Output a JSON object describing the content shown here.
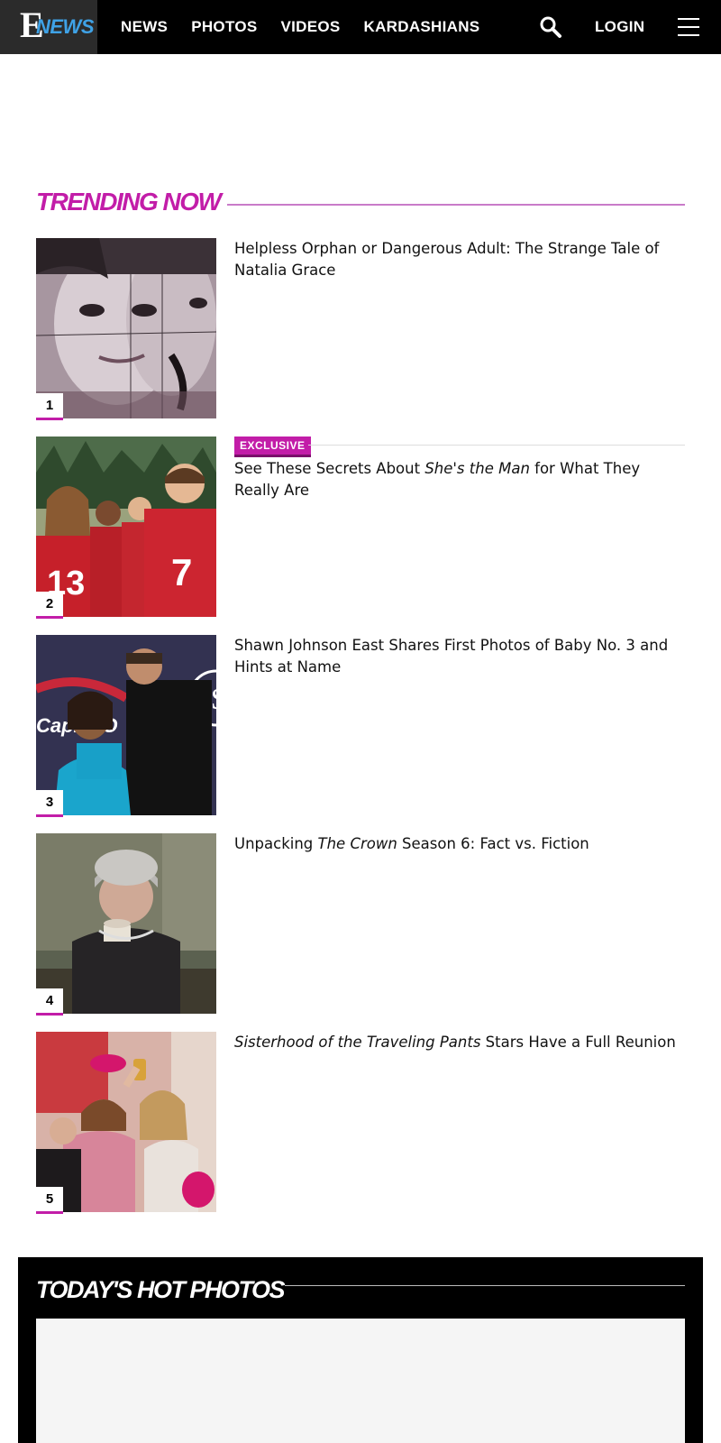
{
  "header": {
    "logo_e": "E",
    "logo_news": "NEWS",
    "nav": [
      "NEWS",
      "PHOTOS",
      "VIDEOS",
      "KARDASHIANS"
    ],
    "login": "LOGIN"
  },
  "trending": {
    "title": "TRENDING NOW",
    "items": [
      {
        "rank": "1",
        "headline": "Helpless Orphan or Dangerous Adult: The Strange Tale of Natalia Grace"
      },
      {
        "rank": "2",
        "badge": "EXCLUSIVE",
        "headline_pre": "See These Secrets About ",
        "headline_em": "She's the Man",
        "headline_post": " for What They Really Are"
      },
      {
        "rank": "3",
        "headline": "Shawn Johnson East Shares First Photos of Baby No. 3 and Hints at Name"
      },
      {
        "rank": "4",
        "headline_pre": "Unpacking ",
        "headline_em": "The Crown",
        "headline_post": " Season 6: Fact vs. Fiction"
      },
      {
        "rank": "5",
        "headline_pre": "",
        "headline_em": "Sisterhood of the Traveling Pants",
        "headline_post": " Stars Have a Full Reunion"
      }
    ]
  },
  "hot_photos": {
    "title": "TODAY'S HOT PHOTOS"
  },
  "colors": {
    "accent": "#c21da8",
    "logo_blue": "#3fa2e6",
    "header_bg": "#000000"
  },
  "icons": [
    "search-icon",
    "menu-icon"
  ]
}
